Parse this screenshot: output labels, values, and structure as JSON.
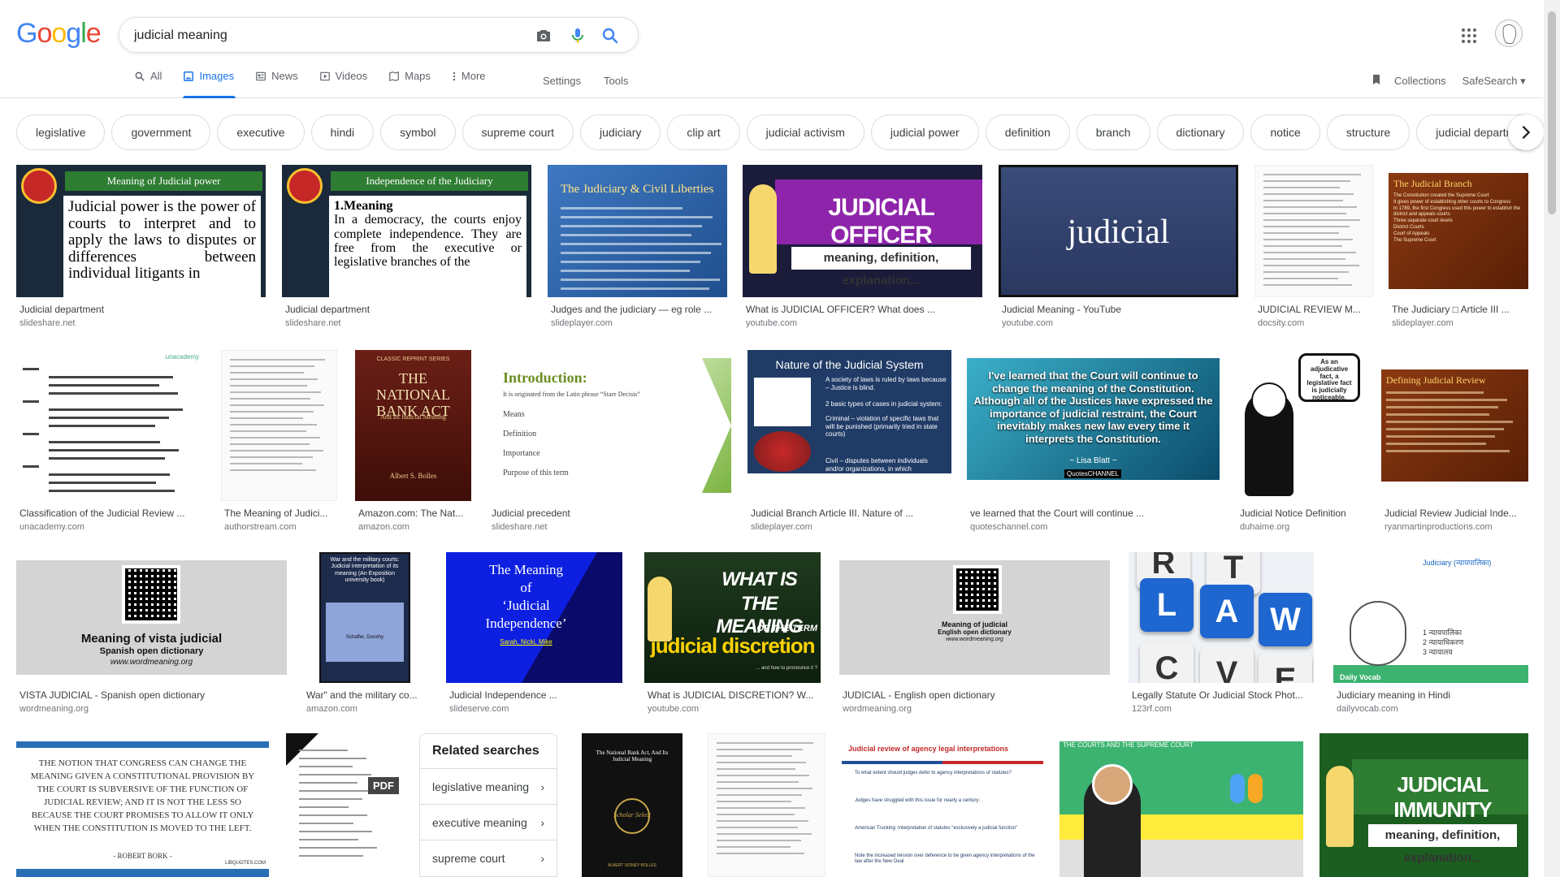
{
  "logo": "Google",
  "search": {
    "query": "judicial meaning"
  },
  "tabs": [
    {
      "label": "All",
      "icon": "search-icon"
    },
    {
      "label": "Images",
      "icon": "image-icon"
    },
    {
      "label": "News",
      "icon": "news-icon"
    },
    {
      "label": "Videos",
      "icon": "video-icon"
    },
    {
      "label": "Maps",
      "icon": "map-icon"
    },
    {
      "label": "More",
      "icon": "more-icon"
    }
  ],
  "tools": {
    "settings": "Settings",
    "tools": "Tools"
  },
  "right_tools": {
    "collections": "Collections",
    "safesearch": "SafeSearch"
  },
  "chips": [
    "legislative",
    "government",
    "executive",
    "hindi",
    "symbol",
    "supreme court",
    "judiciary",
    "clip art",
    "judicial activism",
    "judicial power",
    "definition",
    "branch",
    "dictionary",
    "notice",
    "structure",
    "judicial department",
    "rest"
  ],
  "results": [
    {
      "title": "Judicial department",
      "source": "slideshare.net",
      "thumb": {
        "heading": "Meaning of Judicial power",
        "text": "Judicial power is the power of courts to interpret and to apply the laws to disputes or differences between individual litigants in"
      }
    },
    {
      "title": "Judicial department",
      "source": "slideshare.net",
      "thumb": {
        "heading": "Independence of the Judiciary",
        "text_title": "1.Meaning",
        "text": "In a democracy, the courts enjoy complete independence. They are free from the executive or legislative branches of the"
      }
    },
    {
      "title": "Judges and the judiciary — eg role ...",
      "source": "slideplayer.com",
      "thumb": {
        "heading": "The Judiciary & Civil Liberties"
      }
    },
    {
      "title": "What is JUDICIAL OFFICER? What does ...",
      "source": "youtube.com",
      "thumb": {
        "heading": "JUDICIAL OFFICER",
        "sub": "meaning, definition, explanation..."
      }
    },
    {
      "title": "Judicial Meaning - YouTube",
      "source": "youtube.com",
      "thumb": {
        "heading": "judicial"
      }
    },
    {
      "title": "JUDICIAL REVIEW M...",
      "source": "docsity.com"
    },
    {
      "title": "The Judiciary □ Article III ...",
      "source": "slideplayer.com",
      "thumb": {
        "heading": "The Judicial Branch",
        "lines": [
          "The Constitution created the Supreme Court",
          "It gives power of establishing other courts to Congress",
          "In 1789, the first Congress used this power to establish the district and appeals courts",
          "Three separate court levels",
          "District Courts",
          "Court of Appeals",
          "The Supreme Court"
        ]
      }
    },
    {
      "title": "Classification of the Judicial Review ...",
      "source": "unacademy.com",
      "thumb": {
        "badge": "unacademy"
      }
    },
    {
      "title": "The Meaning of Judici...",
      "source": "authorstream.com"
    },
    {
      "title": "Amazon.com: The Nat...",
      "source": "amazon.com",
      "thumb": {
        "top": "CLASSIC REPRINT SERIES",
        "heading": "THE NATIONAL BANK ACT",
        "sub": "And Its Judicial Meaning",
        "author": "Albert S. Bolles"
      }
    },
    {
      "title": "Judicial precedent",
      "source": "slideshare.net",
      "thumb": {
        "heading": "Introduction:",
        "lines": [
          "It is originated from the Latin phrase “Stare Decisis”",
          "Means",
          "Definition",
          "Importance",
          "Purpose of this term"
        ]
      }
    },
    {
      "title": "Judicial Branch Article III. Nature of ...",
      "source": "slideplayer.com",
      "thumb": {
        "heading": "Nature of the Judicial System",
        "lines": [
          "A society of laws is ruled by laws because – Justice is blind.",
          "2 basic types of cases in judicial system:",
          "Criminal – violation of specific laws that will be punished (primarily tried in state courts)",
          "Civil – disputes between individuals and/or organizations, in which compensation may be awarded to the victim (breach of contract, business, property, divorce)"
        ]
      }
    },
    {
      "title": "ve learned that the Court will continue ...",
      "source": "quoteschannel.com",
      "thumb": {
        "quote": "I've learned that the Court will continue to change the meaning of the Constitution. Although all of the Justices have expressed the importance of judicial restraint, the Court inevitably makes new law every time it interprets the Constitution.",
        "author": "~ Lisa Blatt ~",
        "brand": "QuotesCHANNEL"
      }
    },
    {
      "title": "Judicial Notice Definition",
      "source": "duhaime.org",
      "thumb": {
        "bubble": "As an adjudicative fact, a legislative fact is judicially noticeable."
      }
    },
    {
      "title": "Judicial Review Judicial Inde...",
      "source": "ryanmartinproductions.com",
      "thumb": {
        "heading": "Defining Judicial Review"
      }
    },
    {
      "title": "VISTA JUDICIAL - Spanish open dictionary",
      "source": "wordmeaning.org",
      "thumb": {
        "heading": "Meaning of vista judicial",
        "sub": "Spanish open dictionary",
        "url": "www.wordmeaning.org"
      }
    },
    {
      "title": "War\" and the military co...",
      "source": "amazon.com",
      "thumb": {
        "heading": "War and the military courts: Judicial interpretation of its meaning (An Exposition university book)",
        "author": "Schaffer, Dorothy"
      }
    },
    {
      "title": "Judicial Independence ...",
      "source": "slideserve.com",
      "thumb": {
        "lines": [
          "The Meaning",
          "of",
          "‘Judicial",
          "Independence’"
        ],
        "sub": "Sarah, Nicki, Mike"
      }
    },
    {
      "title": "What is JUDICIAL DISCRETION? W...",
      "source": "youtube.com",
      "thumb": {
        "lines": [
          "WHAT IS",
          "THE MEANING",
          "OF THE TERM"
        ],
        "heading": "judicial discretion",
        "sub": "... and how to pronounce it ?"
      }
    },
    {
      "title": "JUDICIAL - English open dictionary",
      "source": "wordmeaning.org",
      "thumb": {
        "heading": "Meaning of judicial",
        "sub": "English open dictionary",
        "url": "www.wordmeaning.org"
      }
    },
    {
      "title": "Legally Statute Or Judicial Stock Phot...",
      "source": "123rf.com",
      "thumb": {
        "keys": [
          "R",
          "T",
          "L",
          "A",
          "W",
          "C",
          "V",
          "E"
        ]
      }
    },
    {
      "title": "Judiciary meaning in Hindi",
      "source": "dailyvocab.com",
      "thumb": {
        "heading": "Judiciary (न्यायपालिका)",
        "lines": [
          "1 न्यायपालिका",
          "2 न्यायाधिकरण",
          "3 न्यायालय"
        ],
        "brand": "Daily Vocab"
      }
    },
    {
      "thumb": {
        "quote": "THE NOTION THAT CONGRESS CAN CHANGE THE MEANING GIVEN A CONSTITUTIONAL PROVISION BY THE COURT IS SUBVERSIVE OF THE FUNCTION OF JUDICIAL REVIEW; AND IT IS NOT THE LESS SO BECAUSE THE COURT PROMISES TO ALLOW IT ONLY WHEN THE CONSTITUTION IS MOVED TO THE LEFT.",
        "author": "- ROBERT BORK -",
        "brand": "LIBQUOTES.COM"
      }
    },
    {
      "thumb": {
        "badge": "PDF"
      }
    },
    {
      "thumb": {
        "heading": "The National Bank Act, And Its Judicial Meaning",
        "brand": "Scholar Select",
        "author": "ALBERT SIDNEY BOLLES"
      }
    },
    {
      "thumb": {}
    },
    {
      "thumb": {
        "heading": "Judicial review of agency legal interpretations",
        "lines": [
          "To what extent should judges defer to agency interpretations of statutes?",
          "Judges have struggled with this issue for nearly a century:",
          "American Trucking: Interpretation of statutes “exclusively a judicial function”",
          "Note the increased tension over deference to be given agency interpretations of the law after the New Deal"
        ]
      }
    },
    {
      "thumb": {
        "heading": "THE COURTS AND THE SUPREME COURT"
      }
    },
    {
      "thumb": {
        "heading": "JUDICIAL IMMUNITY",
        "sub": "meaning, definition, explanation..."
      }
    }
  ],
  "related": {
    "title": "Related searches",
    "items": [
      "legislative meaning",
      "executive meaning",
      "supreme court"
    ]
  },
  "colors": {
    "accent": "#1a73e8",
    "logo_blue": "#4285f4",
    "logo_red": "#ea4335",
    "logo_yellow": "#fbbc05",
    "logo_green": "#34a853"
  }
}
